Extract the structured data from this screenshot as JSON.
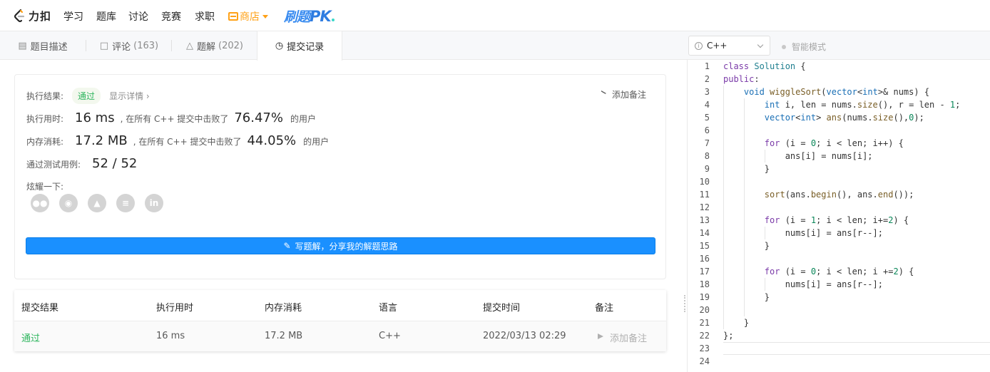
{
  "nav": {
    "logo_text": "力扣",
    "items": [
      "学习",
      "题库",
      "讨论",
      "竞赛",
      "求职"
    ],
    "store": "商店",
    "pk_prefix": "刷题",
    "pk_suffix": "PK"
  },
  "tabs": [
    {
      "label": "题目描述",
      "icon": "description-icon",
      "count": ""
    },
    {
      "label": "评论",
      "icon": "comment-icon",
      "count": "(163)"
    },
    {
      "label": "题解",
      "icon": "flask-icon",
      "count": "(202)"
    },
    {
      "label": "提交记录",
      "icon": "clock-icon",
      "count": ""
    }
  ],
  "editor_bar": {
    "language": "C++",
    "smart_mode": "智能模式"
  },
  "result": {
    "status_label": "执行结果:",
    "status_value": "通过",
    "detail_link": "显示详情 ›",
    "add_note": "添加备注",
    "runtime_label": "执行用时:",
    "runtime_value": "16 ms",
    "runtime_text": ", 在所有 C++ 提交中击败了",
    "runtime_pct": "76.47%",
    "runtime_suffix": "的用户",
    "memory_label": "内存消耗:",
    "memory_value": "17.2 MB",
    "memory_text": ", 在所有 C++ 提交中击败了",
    "memory_pct": "44.05%",
    "memory_suffix": "的用户",
    "tests_label": "通过测试用例:",
    "tests_value": "52 / 52",
    "share_label": "炫耀一下:",
    "share_icons": [
      "wechat-icon",
      "weibo-icon",
      "qq-icon",
      "douban-icon",
      "linkedin-icon"
    ],
    "write_button": "写题解，分享我的解题思路"
  },
  "submissions": {
    "headers": [
      "提交结果",
      "执行用时",
      "内存消耗",
      "语言",
      "提交时间",
      "备注"
    ],
    "rows": [
      {
        "result": "通过",
        "runtime": "16 ms",
        "memory": "17.2 MB",
        "language": "C++",
        "time": "2022/03/13 02:29",
        "note": "添加备注"
      }
    ]
  },
  "code": {
    "line_numbers": [
      "1",
      "2",
      "3",
      "4",
      "5",
      "6",
      "7",
      "8",
      "9",
      "10",
      "11",
      "12",
      "13",
      "14",
      "15",
      "16",
      "17",
      "18",
      "19",
      "20",
      "21",
      "22",
      "23",
      "24"
    ]
  },
  "colors": {
    "accent_blue": "#1a90ff",
    "pass_green": "#2db55d",
    "store_orange": "#ffa116"
  }
}
